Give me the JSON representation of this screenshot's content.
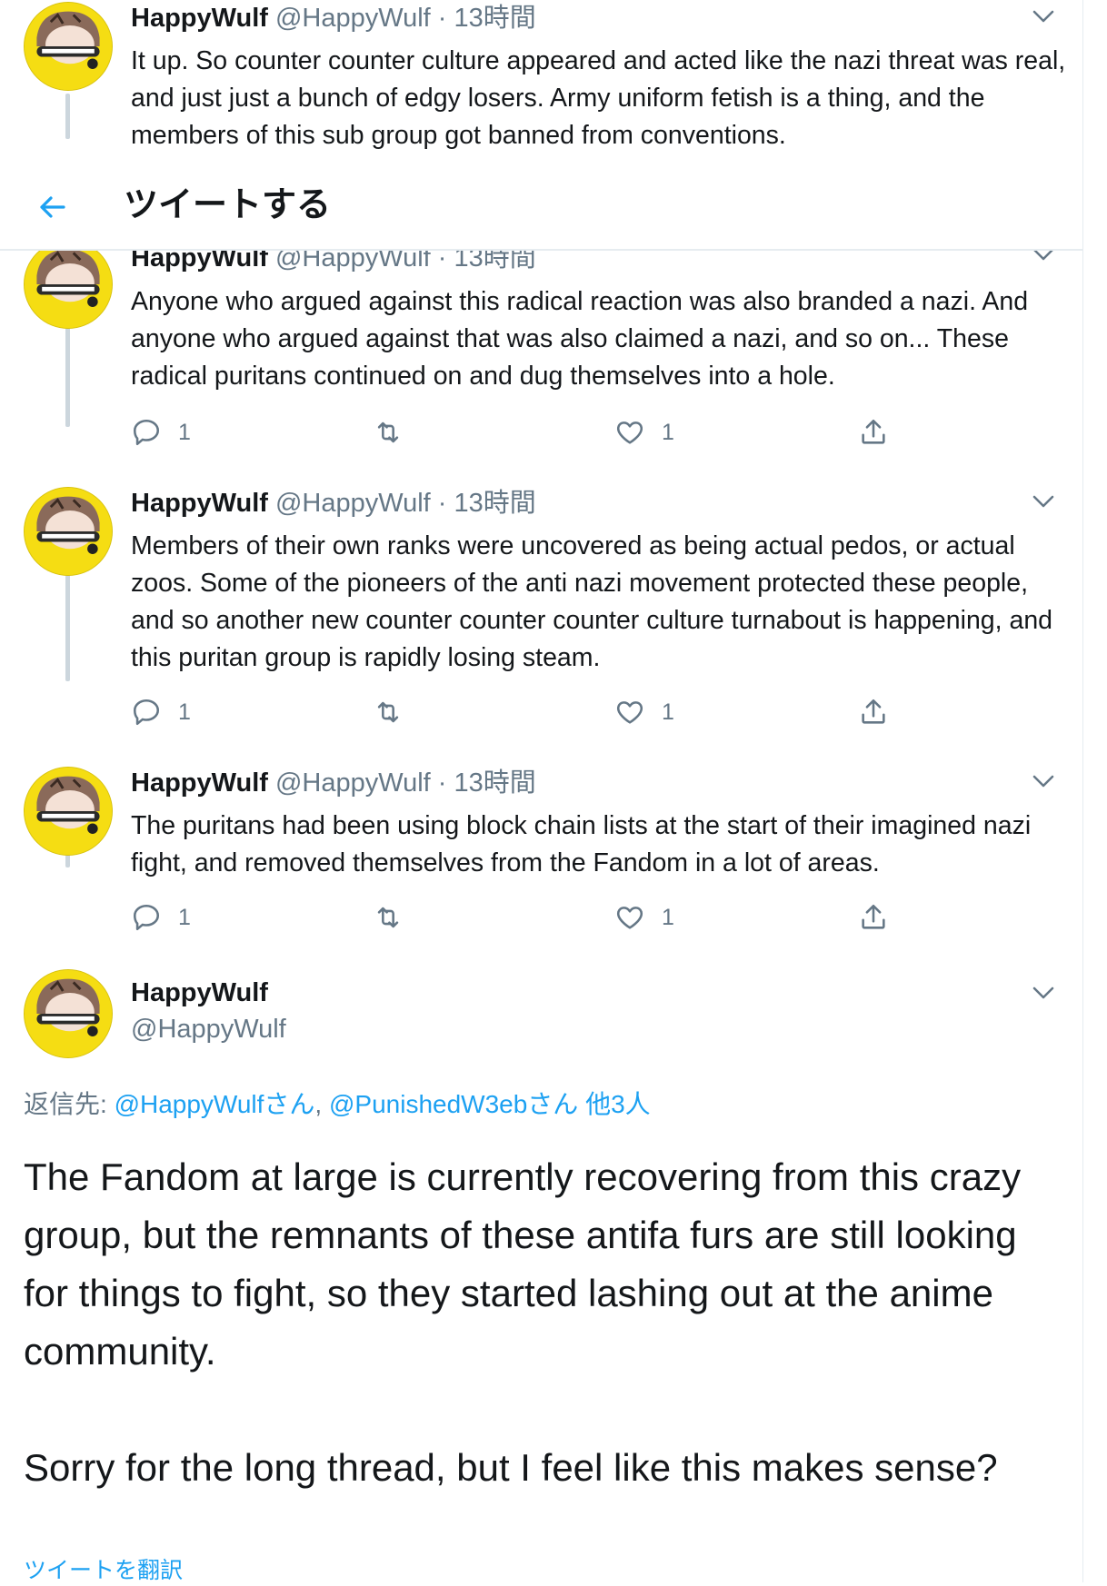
{
  "header": {
    "title": "ツイートする",
    "back_label": "←"
  },
  "tweets": [
    {
      "name": "HappyWulf",
      "handle": "@HappyWulf",
      "dot": "·",
      "time": "13時間",
      "text": "It up. So counter counter culture appeared and acted like the nazi threat was real, and just just a bunch of edgy losers. Army uniform fetish is a thing, and the members of this sub group got banned from conventions."
    },
    {
      "name": "HappyWulf",
      "handle": "@HappyWulf",
      "dot": "·",
      "time": "13時間",
      "text": "Anyone who argued against this radical reaction was also branded a nazi. And anyone who argued against that was also claimed a nazi, and so on... These radical puritans continued on and dug themselves into a hole.",
      "replies": "1",
      "likes": "1"
    },
    {
      "name": "HappyWulf",
      "handle": "@HappyWulf",
      "dot": "·",
      "time": "13時間",
      "text": "Members of their own ranks were uncovered as being actual pedos, or actual zoos. Some of the pioneers of the anti nazi movement protected these people, and so another new counter counter counter culture turnabout is happening, and this puritan group is rapidly losing steam.",
      "replies": "1",
      "likes": "1"
    },
    {
      "name": "HappyWulf",
      "handle": "@HappyWulf",
      "dot": "·",
      "time": "13時間",
      "text": "The puritans had been using block chain lists at the start of their imagined nazi fight, and removed themselves from the Fandom in a lot of areas.",
      "replies": "1",
      "likes": "1"
    }
  ],
  "main_tweet": {
    "name": "HappyWulf",
    "handle": "@HappyWulf",
    "reply_prefix": "返信先: ",
    "mention1": "@HappyWulfさん",
    "sep": ", ",
    "mention2": "@PunishedW3ebさん",
    "others": " 他3人",
    "text": "The Fandom at large is currently recovering from this crazy group, but the remnants of these antifa furs are still looking for things to fight, so they started lashing out at the anime community.\n\nSorry for the long thread, but I feel like this makes sense?",
    "translate": "ツイートを翻訳"
  },
  "colors": {
    "accent": "#1da1f2",
    "muted": "#657786",
    "text": "#14171a",
    "avatar_bg": "#f5dd13",
    "border": "#e6ecf0"
  },
  "icons": [
    "reply-icon",
    "retweet-icon",
    "like-icon",
    "share-icon",
    "chevron-down-icon",
    "back-arrow-icon"
  ]
}
